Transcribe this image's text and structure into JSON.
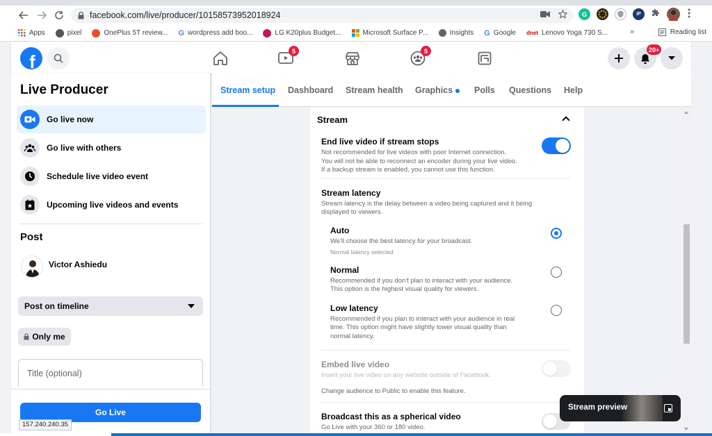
{
  "browser": {
    "url": "facebook.com/live/producer/10158573952018924",
    "bookmarks": [
      {
        "label": "Apps",
        "color": "#5f6368"
      },
      {
        "label": "pixel",
        "color": "#555555"
      },
      {
        "label": "OnePlus 5T review...",
        "color": "#eb4d2a"
      },
      {
        "label": "wordpress add boo...",
        "color": "#4285f4"
      },
      {
        "label": "LG K20plus Budget...",
        "color": "#c2185b"
      },
      {
        "label": "Microsoft Surface P...",
        "color": "#f25022"
      },
      {
        "label": "Insights",
        "color": "#5f6368"
      },
      {
        "label": "Google",
        "color": "#4285f4"
      },
      {
        "label": "Lenovo Yoga 730 S...",
        "color": "#cc0000"
      }
    ],
    "bookmarks_more": "»",
    "reading_list": "Reading list",
    "status_url": "157.240.240.35"
  },
  "header": {
    "logo": "f",
    "video_badge": "5",
    "groups_badge": "5",
    "notifications_badge": "20+"
  },
  "left_panel": {
    "title": "Live Producer",
    "items": [
      {
        "label": "Go live now",
        "icon": "video-camera-icon"
      },
      {
        "label": "Go live with others",
        "icon": "people-icon"
      },
      {
        "label": "Schedule live video event",
        "icon": "clock-icon"
      },
      {
        "label": "Upcoming live videos and events",
        "icon": "calendar-star-icon"
      }
    ],
    "post_title": "Post",
    "user_name": "Victor Ashiedu",
    "post_destination": "Post on timeline",
    "privacy": "Only me",
    "title_placeholder": "Title (optional)",
    "go_live": "Go Live"
  },
  "tabs": [
    {
      "label": "Stream setup",
      "active": true
    },
    {
      "label": "Dashboard"
    },
    {
      "label": "Stream health"
    },
    {
      "label": "Graphics"
    },
    {
      "label": "Polls"
    },
    {
      "label": "Questions"
    },
    {
      "label": "Help"
    }
  ],
  "stream": {
    "header": "Stream",
    "end_if_stops": {
      "title": "End live video if stream stops",
      "desc1": "Not recommended for live videos with poor Internet connection.",
      "desc2": "You will not be able to reconnect an encoder during your live video.",
      "desc3": "If a backup stream is enabled, you cannot use this function.",
      "enabled": true
    },
    "latency": {
      "title": "Stream latency",
      "desc1": "Stream latency is the delay between a video being captured and it being",
      "desc2": "displayed to viewers.",
      "options": [
        {
          "title": "Auto",
          "desc1": "We'll choose the best latency for your broadcast.",
          "desc2": "",
          "desc3": "",
          "sub": "Normal latency selected",
          "checked": true
        },
        {
          "title": "Normal",
          "desc1": "Recommended if you don't plan to interact with your audience.",
          "desc2": "This option is the highest visual quality for viewers.",
          "desc3": "",
          "sub": "",
          "checked": false
        },
        {
          "title": "Low latency",
          "desc1": "Recommended if you plan to interact with your audience in real",
          "desc2": "time. This option might have slightly lower visual quality than",
          "desc3": "normal latency.",
          "sub": "",
          "checked": false
        }
      ]
    },
    "embed": {
      "title": "Embed live video",
      "desc": "Insert your live video on any website outside of Facebook.",
      "note": "Change audience to Public to enable this feature.",
      "enabled": false
    },
    "spherical": {
      "title": "Broadcast this as a spherical video",
      "desc": "Go Live with your 360 or 180 video.",
      "enabled": false
    }
  },
  "preview": {
    "label": "Stream preview"
  },
  "colors": {
    "accent": "#1877f2",
    "badge": "#e41e3f"
  }
}
